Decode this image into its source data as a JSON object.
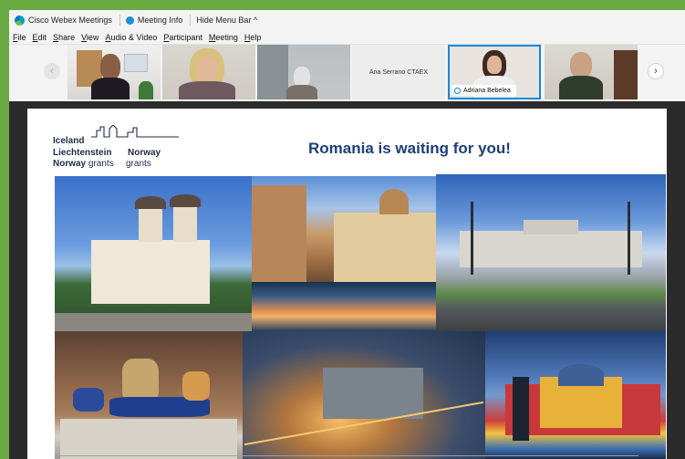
{
  "titlebar": {
    "app_name": "Cisco Webex Meetings",
    "meeting_info": "Meeting Info",
    "hide_menu": "Hide Menu Bar ^"
  },
  "menu": [
    "File",
    "Edit",
    "Share",
    "View",
    "Audio & Video",
    "Participant",
    "Meeting",
    "Help"
  ],
  "participants": {
    "tile4_name": "Ana Serrano CTAEX",
    "tile5_name": "Adriana Bebelea"
  },
  "navigation": {
    "prev_icon": "‹",
    "next_icon": "›"
  },
  "slide": {
    "logo": {
      "line1": "Iceland",
      "line2a": "Liechtenstein",
      "line2b": "Norway",
      "line3a_bold": "Norway",
      "line3a_rest": "grants",
      "line3b": "grants"
    },
    "title": "Romania is waiting for you!"
  },
  "colors": {
    "accent": "#0a8ad6",
    "title": "#1c3f77",
    "frame": "#6aaa43"
  },
  "icons": [
    "webex-logo-icon",
    "info-icon",
    "chevron-left-icon",
    "chevron-right-icon",
    "mic-icon",
    "eea-grants-logo-icon"
  ]
}
